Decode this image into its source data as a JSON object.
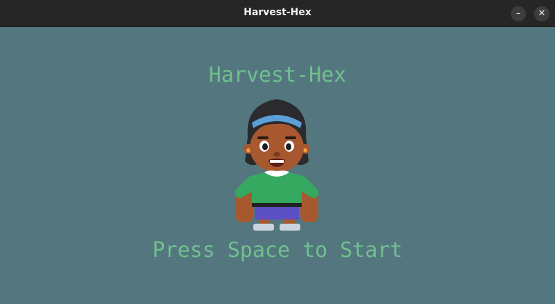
{
  "window": {
    "title": "Harvest-Hex",
    "minimize_glyph": "–",
    "close_glyph": "✕"
  },
  "game": {
    "title": "Harvest-Hex",
    "prompt": "Press Space to Start",
    "text_color": "#6fc08f",
    "background_color": "#54777f"
  },
  "character": {
    "icon": "farmer-girl-character",
    "hair_color": "#2b2b2f",
    "headband_color": "#5b9fd6",
    "skin_color": "#a8582f",
    "shirt_color": "#34a95f",
    "shorts_color": "#5c4fc4",
    "shoe_color": "#c9d3de"
  }
}
